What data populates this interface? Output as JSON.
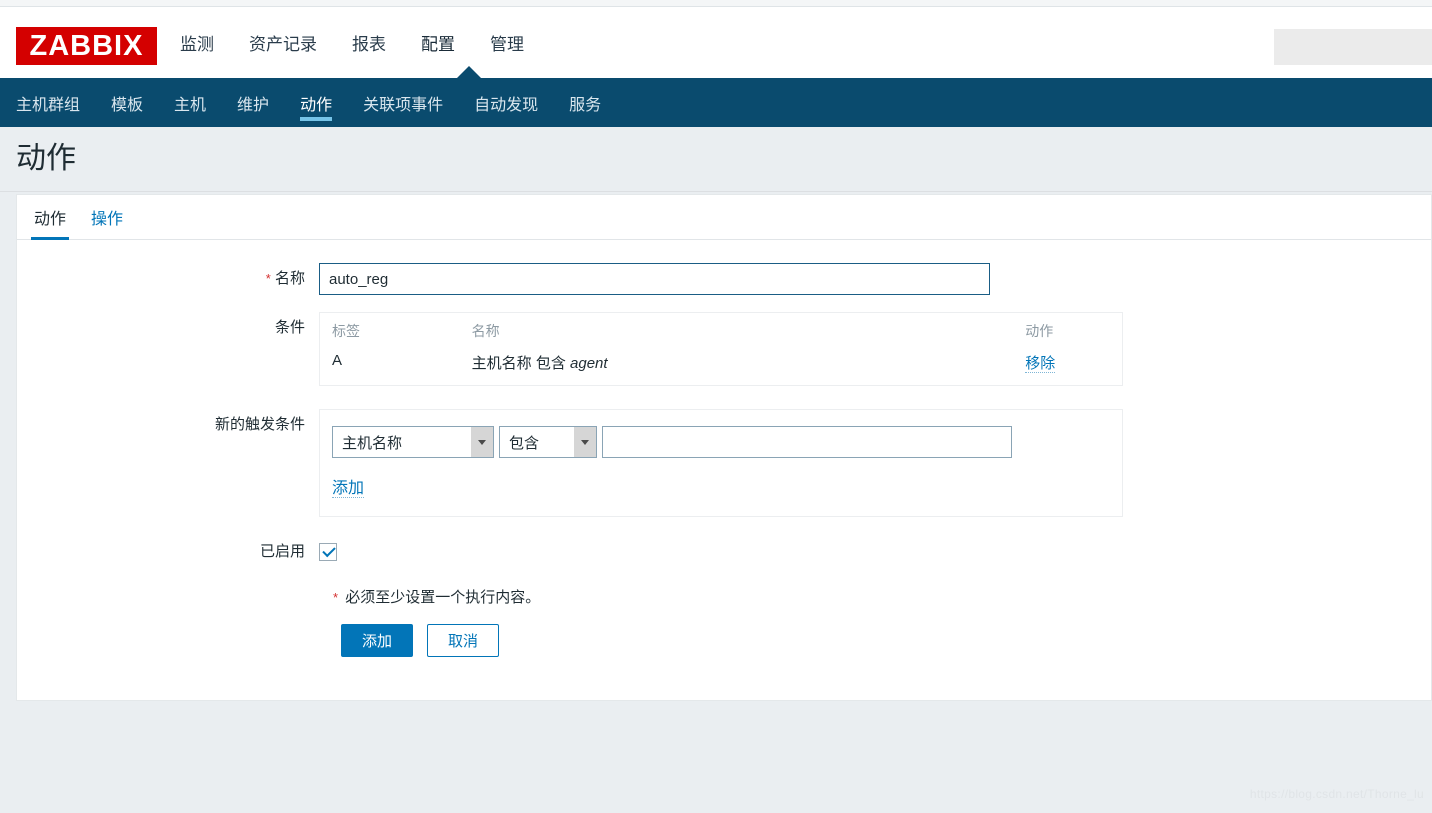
{
  "brand": {
    "logo_text": "ZABBIX",
    "logo_color": "#d40000"
  },
  "colors": {
    "accent": "#0275b8",
    "nav_bg": "#0a4b6e",
    "page_bg": "#eaeef1",
    "required": "#d42f2f",
    "subnav_underline": "#76c4e8"
  },
  "main_menu": {
    "items": [
      {
        "label": "监测",
        "active": false
      },
      {
        "label": "资产记录",
        "active": false
      },
      {
        "label": "报表",
        "active": false
      },
      {
        "label": "配置",
        "active": true
      },
      {
        "label": "管理",
        "active": false
      }
    ]
  },
  "search": {
    "value": "",
    "placeholder": ""
  },
  "subnav": {
    "items": [
      {
        "label": "主机群组",
        "active": false
      },
      {
        "label": "模板",
        "active": false
      },
      {
        "label": "主机",
        "active": false
      },
      {
        "label": "维护",
        "active": false
      },
      {
        "label": "动作",
        "active": true
      },
      {
        "label": "关联项事件",
        "active": false
      },
      {
        "label": "自动发现",
        "active": false
      },
      {
        "label": "服务",
        "active": false
      }
    ]
  },
  "page": {
    "title": "动作"
  },
  "tabs": [
    {
      "label": "动作",
      "active": true
    },
    {
      "label": "操作",
      "active": false
    }
  ],
  "form": {
    "name": {
      "label": "名称",
      "required_marker": "*",
      "value": "auto_reg",
      "placeholder": ""
    },
    "conditions": {
      "label": "条件",
      "headers": {
        "tag": "标签",
        "name": "名称",
        "action": "动作"
      },
      "rows": [
        {
          "tag": "A",
          "name_prefix": "主机名称 包含 ",
          "name_value": "agent",
          "action_label": "移除"
        }
      ]
    },
    "new_condition": {
      "label": "新的触发条件",
      "type_select": {
        "value": "主机名称"
      },
      "operator_select": {
        "value": "包含"
      },
      "value_input": {
        "value": "",
        "placeholder": ""
      },
      "add_label": "添加"
    },
    "enabled": {
      "label": "已启用",
      "checked": true
    },
    "note": {
      "required_marker": "*",
      "text": "必须至少设置一个执行内容。"
    },
    "buttons": {
      "submit": "添加",
      "cancel": "取消"
    }
  },
  "watermark": {
    "text": "https://blog.csdn.net/Thorne_lu"
  }
}
